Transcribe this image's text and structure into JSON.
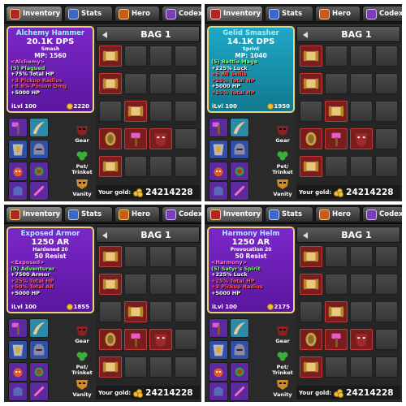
{
  "tabs": {
    "inventory": "Inventory",
    "stats": "Stats",
    "hero": "Hero",
    "codex": "Codex"
  },
  "bag_title": "BAG 1",
  "your_gold_label": "Your gold:",
  "gold": "24214228",
  "equip_labels": {
    "gear": "Gear",
    "pet_trinket": "Pet/ Trinket",
    "vanity": "Vanity"
  },
  "colors": {
    "purple_card": "#6a1fb8",
    "teal_card": "#1a98b8",
    "red_slot": "#7a1d1d"
  },
  "panels": [
    {
      "card_color": "purple",
      "name": "Alchemy Hammer",
      "stat": "20.1K DPS",
      "stat_type": "Smash",
      "secondary": "MP: 1560",
      "lines": [
        {
          "text": "<Alchemy>",
          "color": "#ff7be6"
        },
        {
          "text": "(5) Plagued",
          "color": "#7dff6a"
        },
        {
          "text": "+75% Total HP",
          "color": "#ffffff"
        },
        {
          "text": "+3 Pickup Radius",
          "color": "#ff5a5a"
        },
        {
          "text": "+8.6% Poison Dmg",
          "color": "#ff5a5a"
        },
        {
          "text": "+5000 HP",
          "color": "#ffffff"
        }
      ],
      "level": "iLvl 100",
      "price": "2220"
    },
    {
      "card_color": "teal",
      "name": "Gelid Smasher",
      "stat": "14.1K DPS",
      "stat_type": "Sprint",
      "secondary": "MP: 1040",
      "lines": [
        {
          "text": "(5) Battle Mage",
          "color": "#7dff6a"
        },
        {
          "text": "+225% Luck",
          "color": "#ffffff"
        },
        {
          "text": "+5 All Skills",
          "color": "#ff5a5a"
        },
        {
          "text": "+25% Total HP",
          "color": "#ff5a5a"
        },
        {
          "text": "+5000 HP",
          "color": "#ffffff"
        },
        {
          "text": "+25% Total HP",
          "color": "#ff5a5a"
        }
      ],
      "level": "iLvl 100",
      "price": "1950"
    },
    {
      "card_color": "purple",
      "name": "Exposed Armor",
      "stat": "1250 AR",
      "stat_type": "Hardened 20",
      "secondary": "50 Resist",
      "lines": [
        {
          "text": "<Exposed>",
          "color": "#ff7be6"
        },
        {
          "text": "(5) Adventurer",
          "color": "#7dff6a"
        },
        {
          "text": "+7500 Armor",
          "color": "#ffffff"
        },
        {
          "text": "+25% Total HP",
          "color": "#ff5a5a"
        },
        {
          "text": "+50% Total AR",
          "color": "#ff5a5a"
        },
        {
          "text": "+5000 HP",
          "color": "#ffffff"
        }
      ],
      "level": "iLvl 100",
      "price": "1855"
    },
    {
      "card_color": "purple",
      "name": "Harmony Helm",
      "stat": "1250 AR",
      "stat_type": "Provocation 20",
      "secondary": "50 Resist",
      "lines": [
        {
          "text": "<Harmony>",
          "color": "#ff7be6"
        },
        {
          "text": "(5) Satyr's Spirit",
          "color": "#7dff6a"
        },
        {
          "text": "+225% Luck",
          "color": "#ffffff"
        },
        {
          "text": "+25% Total HP",
          "color": "#ff5a5a"
        },
        {
          "text": "+3 Pickup Radius",
          "color": "#ff5a5a"
        },
        {
          "text": "+5000 HP",
          "color": "#ffffff"
        }
      ],
      "level": "iLvl 100",
      "price": "2175"
    }
  ]
}
